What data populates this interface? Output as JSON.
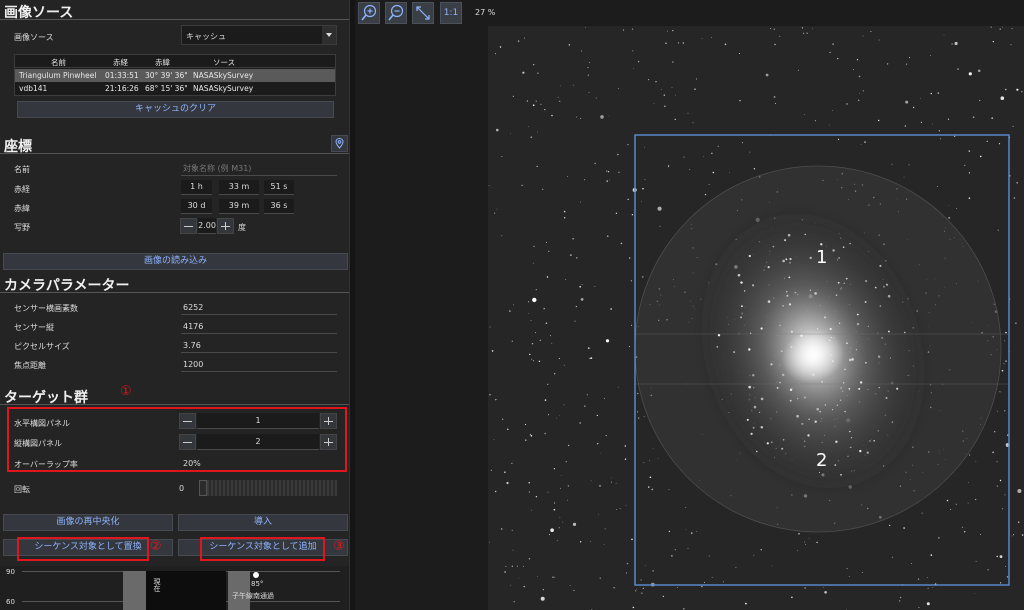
{
  "image_source": {
    "title": "画像ソース",
    "label": "画像ソース",
    "selected": "キャッシュ",
    "columns": [
      "名前",
      "赤経",
      "赤緯",
      "ソース"
    ],
    "rows": [
      [
        "Triangulum Pinwheel",
        "01:33:51",
        "30° 39' 36\"",
        "NASASkySurvey"
      ],
      [
        "vdb141",
        "21:16:26",
        "68° 15' 36\"",
        "NASASkySurvey"
      ]
    ],
    "clear_button": "キャッシュのクリア"
  },
  "coords": {
    "title": "座標",
    "name_label": "名前",
    "name_placeholder": "対象名称 (例 M31)",
    "ra_label": "赤経",
    "ra_h": "1",
    "ra_h_unit": "h",
    "ra_m": "33",
    "ra_m_unit": "m",
    "ra_s": "51",
    "ra_s_unit": "s",
    "dec_label": "赤緯",
    "dec_d": "30",
    "dec_d_unit": "d",
    "dec_m": "39",
    "dec_m_unit": "m",
    "dec_s": "36",
    "dec_s_unit": "s",
    "fov_label": "写野",
    "fov_value": "2.00",
    "fov_unit": "度",
    "load_button": "画像の読み込み"
  },
  "camera": {
    "title": "カメラパラメーター",
    "params": [
      {
        "label": "センサー横画素数",
        "value": "6252"
      },
      {
        "label": "センサー縦",
        "value": "4176"
      },
      {
        "label": "ピクセルサイズ",
        "value": "3.76"
      },
      {
        "label": "焦点距離",
        "value": "1200"
      }
    ]
  },
  "targets": {
    "title": "ターゲット群",
    "annotation1": "①",
    "h_panels_label": "水平構図パネル",
    "h_panels_value": "1",
    "v_panels_label": "縦構図パネル",
    "v_panels_value": "2",
    "overlap_label": "オーバーラップ率",
    "overlap_value": "20%",
    "rotation_label": "回転",
    "rotation_value": "0"
  },
  "actions": {
    "recenter": "画像の再中央化",
    "import": "導入",
    "replace": "シーケンス対象として置換",
    "add": "シーケンス対象として追加",
    "annotation2": "②",
    "annotation3": "③"
  },
  "altitude_chart": {
    "y_top": "90",
    "y_mid": "60",
    "now_label": "現在",
    "meridian_alt": "85°",
    "meridian_label": "子午線南通過"
  },
  "viewer": {
    "zoom_level": "27 %",
    "one_to_one": "1:1",
    "panel_labels": [
      "1",
      "2"
    ],
    "zoom_in_icon": "zoom-in-icon",
    "zoom_out_icon": "zoom-out-icon",
    "fit_icon": "fit-diagonal-icon"
  }
}
